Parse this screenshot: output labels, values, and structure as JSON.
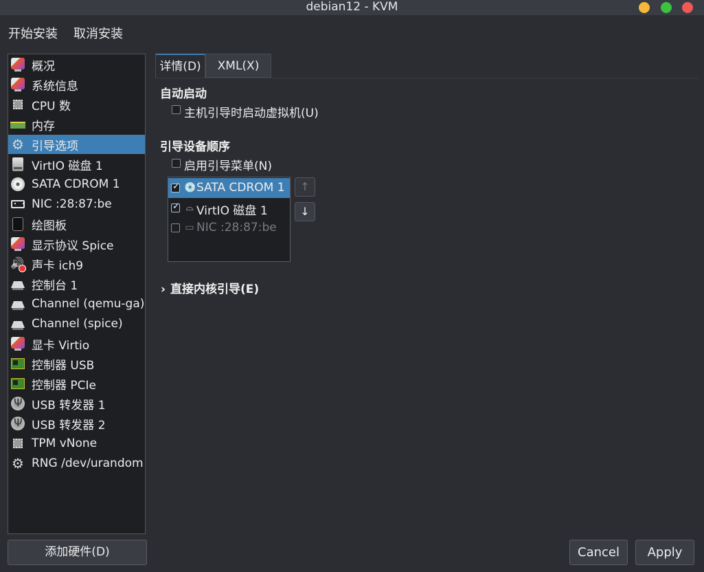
{
  "window": {
    "title": "debian12 - KVM"
  },
  "menubar": {
    "begin_install": "开始安装",
    "cancel_install": "取消安装"
  },
  "hardware_list": [
    {
      "label": "概况",
      "icon": "monitor-icon"
    },
    {
      "label": "系统信息",
      "icon": "monitor-icon"
    },
    {
      "label": "CPU 数",
      "icon": "cpu-chip-icon"
    },
    {
      "label": "内存",
      "icon": "memory-icon"
    },
    {
      "label": "引导选项",
      "icon": "gear-icon",
      "selected": true
    },
    {
      "label": "VirtIO 磁盘 1",
      "icon": "disk-icon"
    },
    {
      "label": "SATA CDROM 1",
      "icon": "cdrom-icon"
    },
    {
      "label": "NIC :28:87:be",
      "icon": "nic-icon"
    },
    {
      "label": "绘图板",
      "icon": "tablet-icon"
    },
    {
      "label": "显示协议 Spice",
      "icon": "monitor-icon"
    },
    {
      "label": "声卡 ich9",
      "icon": "sound-icon"
    },
    {
      "label": "控制台 1",
      "icon": "serial-icon"
    },
    {
      "label": "Channel (qemu-ga)",
      "icon": "serial-icon"
    },
    {
      "label": "Channel (spice)",
      "icon": "serial-icon"
    },
    {
      "label": "显卡 Virtio",
      "icon": "monitor-icon"
    },
    {
      "label": "控制器 USB",
      "icon": "pci-card-icon"
    },
    {
      "label": "控制器 PCIe",
      "icon": "pci-card-icon"
    },
    {
      "label": "USB 转发器 1",
      "icon": "usb-icon"
    },
    {
      "label": "USB 转发器 2",
      "icon": "usb-icon"
    },
    {
      "label": "TPM vNone",
      "icon": "cpu-chip-icon"
    },
    {
      "label": "RNG /dev/urandom",
      "icon": "gear-icon"
    }
  ],
  "add_hardware": "添加硬件(D)",
  "tabs": {
    "details": "详情(D)",
    "xml": "XML(X)"
  },
  "autostart": {
    "title": "自动启动",
    "checkbox_label": "主机引导时启动虚拟机(U)",
    "checked": false
  },
  "boot_order": {
    "title": "引导设备顺序",
    "enable_menu_label": "启用引导菜单(N)",
    "enable_menu_checked": false,
    "devices": [
      {
        "label": "SATA CDROM 1",
        "icon": "cdrom-icon",
        "checked": true,
        "selected": true
      },
      {
        "label": "VirtIO 磁盘 1",
        "icon": "disk-icon",
        "checked": true,
        "selected": false
      },
      {
        "label": "NIC :28:87:be",
        "icon": "nic-icon",
        "checked": false,
        "selected": false
      }
    ],
    "move_up": "↑",
    "move_down": "↓"
  },
  "direct_kernel_boot": {
    "label": "直接内核引导(E)",
    "expanded": false
  },
  "buttons": {
    "cancel": "Cancel",
    "apply": "Apply"
  }
}
